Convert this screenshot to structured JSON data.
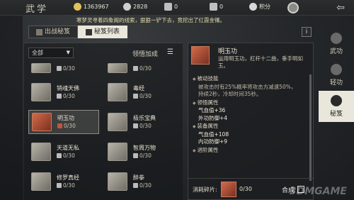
{
  "header": {
    "title": "武学",
    "resources": [
      {
        "icon": "silver-coin-icon",
        "value": "1363967",
        "color": "#e0c25a"
      },
      {
        "icon": "gold-ingot-icon",
        "value": "2828",
        "color": "#cfcfcf"
      },
      {
        "icon": "ticket-icon",
        "value": "0",
        "color": "#bfbfbf"
      },
      {
        "icon": "jade-icon",
        "value": "0",
        "color": "#bfbfbf"
      }
    ],
    "points_label": "积分"
  },
  "marquee": "寒梦灵寻着四象阁的线索，狠狠一铲下去，竟挖出了红霞金镯。",
  "tabs": [
    {
      "label": "出战秘笈",
      "active": false
    },
    {
      "label": "秘笈列表",
      "active": true
    }
  ],
  "info_label": "i",
  "filter": {
    "value": "全部"
  },
  "sort_label": "领悟加成",
  "cards": [
    {
      "name": "",
      "count": "0/30",
      "red": false
    },
    {
      "name": "",
      "count": "0/30",
      "red": false
    },
    {
      "name": "销魂天佛",
      "count": "0/30",
      "red": false
    },
    {
      "name": "毒经",
      "count": "0/30",
      "red": false
    },
    {
      "name": "明玉功",
      "count": "0/30",
      "red": true,
      "selected": true
    },
    {
      "name": "极乐宝典",
      "count": "0/30",
      "red": false
    },
    {
      "name": "天道无私",
      "count": "0/30",
      "red": false
    },
    {
      "name": "智周万物",
      "count": "0/30",
      "red": false
    },
    {
      "name": "修罗真经",
      "count": "0/30",
      "red": false
    },
    {
      "name": "醉拳",
      "count": "0/30",
      "red": false
    }
  ],
  "detail": {
    "name": "明玉功",
    "desc": "运用明玉功，杠杆十二曲，垂手明如玉。",
    "sections": [
      {
        "title": "被动技能",
        "lines": [
          "被攻击时有25%概率将攻击方减速50%，",
          "持续2秒，冷却时间35秒。"
        ],
        "attr": false
      },
      {
        "title": "领悟属性",
        "lines": [
          "气血值+36",
          "外功防御+4"
        ],
        "attr": true
      },
      {
        "title": "装备属性",
        "lines": [
          "气血值+108",
          "内功防御+9"
        ],
        "attr": true
      },
      {
        "title": "进阶属性",
        "lines": [],
        "attr": false
      }
    ],
    "cost_label": "消耗碎片:",
    "cost_count": "0/30",
    "synth_label": "合成"
  },
  "sidebar": [
    {
      "label": "武功",
      "active": false
    },
    {
      "label": "轻功",
      "active": false
    },
    {
      "label": "秘笈",
      "active": true
    }
  ],
  "watermark": "3DMGAME"
}
